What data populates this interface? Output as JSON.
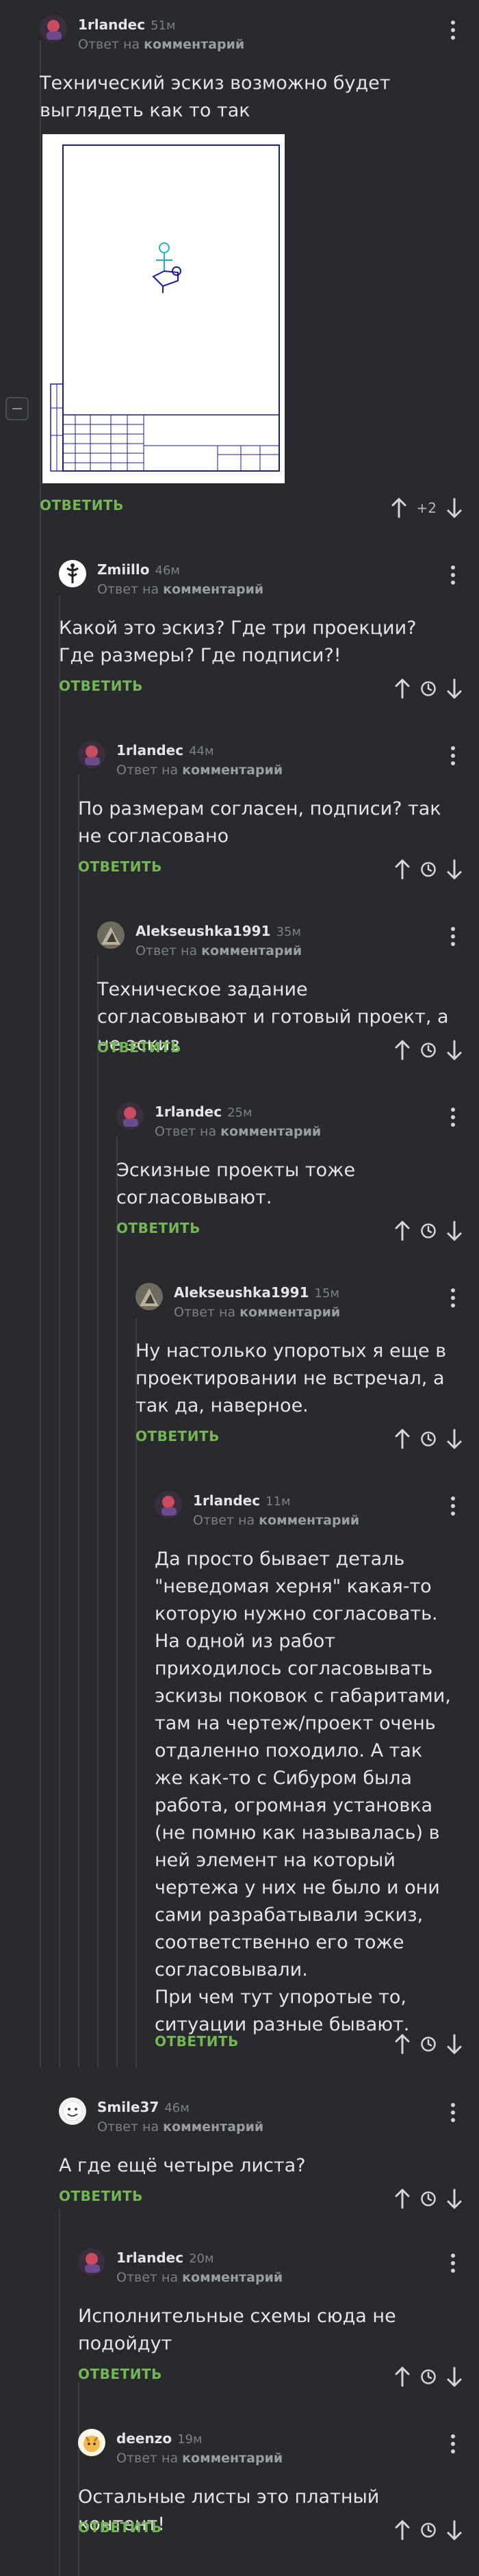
{
  "reply_label": "ОТВЕТИТЬ",
  "reply_prefix": "Ответ на",
  "reply_target": "комментарий",
  "comments": [
    {
      "author": "1rlandec",
      "time": "51м",
      "text": "Технический эскиз возможно будет выглядеть как то так",
      "rating": "+2"
    },
    {
      "author": "Zmiillo",
      "time": "46м",
      "text": "Какой это эскиз? Где три проекции? Где размеры? Где подписи?!"
    },
    {
      "author": "1rlandec",
      "time": "44м",
      "text": "По размерам согласен, подписи? так не согласовано"
    },
    {
      "author": "Alekseushka1991",
      "time": "35м",
      "text": "Техническое задание согласовывают и готовый проект, а не эскиз"
    },
    {
      "author": "1rlandec",
      "time": "25м",
      "text": "Эскизные проекты тоже согласовывают."
    },
    {
      "author": "Alekseushka1991",
      "time": "15м",
      "text": "Ну настолько упоротых я еще в проектировании не встречал, а так да, наверное."
    },
    {
      "author": "1rlandec",
      "time": "11м",
      "text": "Да просто бывает деталь \"неведомая херня\" какая-то которую нужно согласовать.\nНа одной из работ приходилось согласовывать эскизы поковок с габаритами, там на чертеж/проект очень отдаленно походило. А так же как-то с Сибуром была работа, огромная установка (не помню как называлась) в ней элемент на который чертежа у них не было и они сами разрабатывали эскиз, соответственно его тоже согласовывали.\nПри чем тут упоротые то, ситуации разные бывают."
    },
    {
      "author": "Smile37",
      "time": "46м",
      "text": "А где ещё четыре листа?"
    },
    {
      "author": "1rlandec",
      "time": "20м",
      "text": "Исполнительные схемы сюда не подойдут"
    },
    {
      "author": "deenzo",
      "time": "19м",
      "text": "Остальные листы это платный контент!"
    }
  ]
}
